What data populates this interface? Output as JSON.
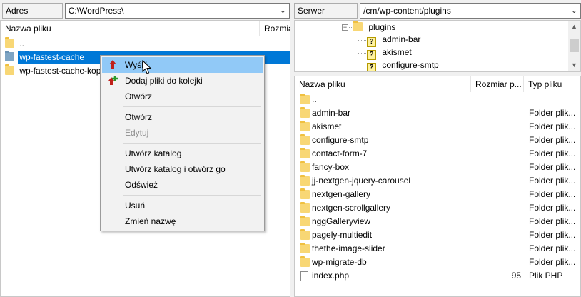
{
  "local": {
    "label": "Adres lokalny:",
    "path": "C:\\WordPress\\",
    "columns": {
      "name": "Nazwa pliku",
      "size": "Rozmia"
    },
    "items": [
      {
        "name": "..",
        "selected": false
      },
      {
        "name": "wp-fastest-cache",
        "selected": true
      },
      {
        "name": "wp-fastest-cache-kop",
        "selected": false
      }
    ]
  },
  "remote": {
    "label": "Serwer zdalny:",
    "path": "/cm/wp-content/plugins",
    "tree": [
      {
        "name": "plugins",
        "icon": "folder",
        "expander": "-"
      },
      {
        "name": "admin-bar",
        "icon": "question"
      },
      {
        "name": "akismet",
        "icon": "question"
      },
      {
        "name": "configure-smtp",
        "icon": "question"
      }
    ],
    "columns": {
      "name": "Nazwa pliku",
      "size": "Rozmiar p...",
      "type": "Typ pliku"
    },
    "items": [
      {
        "name": "..",
        "size": "",
        "type": "",
        "icon": "folder"
      },
      {
        "name": "admin-bar",
        "size": "",
        "type": "Folder plik...",
        "icon": "folder"
      },
      {
        "name": "akismet",
        "size": "",
        "type": "Folder plik...",
        "icon": "folder"
      },
      {
        "name": "configure-smtp",
        "size": "",
        "type": "Folder plik...",
        "icon": "folder"
      },
      {
        "name": "contact-form-7",
        "size": "",
        "type": "Folder plik...",
        "icon": "folder"
      },
      {
        "name": "fancy-box",
        "size": "",
        "type": "Folder plik...",
        "icon": "folder"
      },
      {
        "name": "jj-nextgen-jquery-carousel",
        "size": "",
        "type": "Folder plik...",
        "icon": "folder"
      },
      {
        "name": "nextgen-gallery",
        "size": "",
        "type": "Folder plik...",
        "icon": "folder"
      },
      {
        "name": "nextgen-scrollgallery",
        "size": "",
        "type": "Folder plik...",
        "icon": "folder"
      },
      {
        "name": "nggGalleryview",
        "size": "",
        "type": "Folder plik...",
        "icon": "folder"
      },
      {
        "name": "pagely-multiedit",
        "size": "",
        "type": "Folder plik...",
        "icon": "folder"
      },
      {
        "name": "thethe-image-slider",
        "size": "",
        "type": "Folder plik...",
        "icon": "folder"
      },
      {
        "name": "wp-migrate-db",
        "size": "",
        "type": "Folder plik...",
        "icon": "folder"
      },
      {
        "name": "index.php",
        "size": "95",
        "type": "Plik PHP",
        "icon": "file"
      }
    ]
  },
  "context_menu": {
    "items": [
      {
        "label": "Wyślij",
        "icon": "upload-arrow-icon",
        "highlighted": true,
        "disabled": false
      },
      {
        "label": "Dodaj pliki do kolejki",
        "icon": "add-to-queue-icon",
        "highlighted": false,
        "disabled": false
      },
      {
        "label": "Otwórz",
        "highlighted": false,
        "disabled": false
      },
      {
        "separator": true
      },
      {
        "label": "Otwórz",
        "highlighted": false,
        "disabled": false
      },
      {
        "label": "Edytuj",
        "highlighted": false,
        "disabled": true
      },
      {
        "separator": true
      },
      {
        "label": "Utwórz katalog",
        "highlighted": false,
        "disabled": false
      },
      {
        "label": "Utwórz katalog i otwórz go",
        "highlighted": false,
        "disabled": false
      },
      {
        "label": "Odśwież",
        "highlighted": false,
        "disabled": false
      },
      {
        "separator": true
      },
      {
        "label": "Usuń",
        "highlighted": false,
        "disabled": false
      },
      {
        "label": "Zmień nazwę",
        "highlighted": false,
        "disabled": false
      }
    ]
  },
  "colors": {
    "selection": "#0078d7",
    "menu_highlight": "#91c9f7",
    "folder": "#f8d775"
  }
}
